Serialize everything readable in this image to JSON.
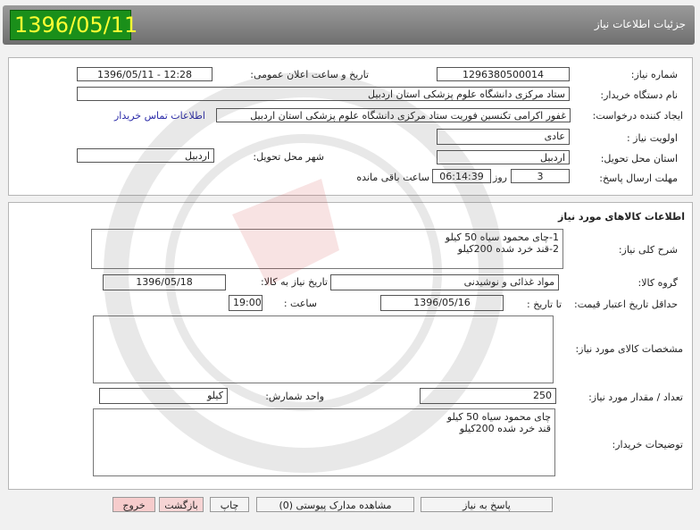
{
  "header": {
    "date": "1396/05/11",
    "title": "جزئیات اطلاعات نیاز"
  },
  "need": {
    "need_number_label": "شماره نیاز:",
    "need_number": "1296380500014",
    "announce_label": "تاریخ و ساعت اعلان عمومی:",
    "announce_value": "1396/05/11 - 12:28",
    "buyer_label": "نام دستگاه خریدار:",
    "buyer_value": "ستاد مرکزی دانشگاه علوم پزشکی استان اردبیل",
    "creator_label": "ایجاد کننده درخواست:",
    "creator_value": "غفور اکرامی تکنسین فوریت ستاد مرکزی دانشگاه علوم پزشکی استان اردبیل",
    "contact_link": "اطلاعات تماس خریدار",
    "priority_label": "اولویت نیاز :",
    "priority_value": "عادی",
    "province_label": "استان محل تحویل:",
    "province_value": "اردبیل",
    "city_label": "شهر محل تحویل:",
    "city_value": "اردبیل",
    "deadline_label": "مهلت ارسال پاسخ:",
    "deadline_days": "3",
    "days_word": "روز و",
    "deadline_time": "06:14:39",
    "remaining_word": "ساعت باقی مانده"
  },
  "goods": {
    "section_title": "اطلاعات کالاهای مورد نیاز",
    "summary_label": "شرح کلی نیاز:",
    "summary_line1": "1-چای محمود سیاه  50 کیلو",
    "summary_line2": "2-قند خرد شده   200کیلو",
    "group_label": "گروه کالا:",
    "group_value": "مواد غذائی و نوشیدنی",
    "need_date_label": "تاریخ نیاز به کالا:",
    "need_date_value": "1396/05/18",
    "min_validity_label": "حداقل تاریخ اعتبار قیمت:",
    "until_date_label": "تا تاریخ :",
    "until_date_value": "1396/05/16",
    "time_label": "ساعت :",
    "time_value": "19:00",
    "specs_label": "مشخصات کالای مورد نیاز:",
    "specs_value": "",
    "qty_label": "تعداد / مقدار مورد نیاز:",
    "qty_value": "250",
    "unit_label": "واحد شمارش:",
    "unit_value": "کیلو",
    "desc_label": "توضیحات خریدار:",
    "desc_line1": "چای محمود سیاه 50 کیلو",
    "desc_line2": "قند خرد شده 200کیلو"
  },
  "buttons": {
    "reply": "پاسخ به نیاز",
    "attachments": "مشاهده مدارک پیوستی (0)",
    "print": "چاپ",
    "back": "بازگشت",
    "exit": "خروج"
  }
}
